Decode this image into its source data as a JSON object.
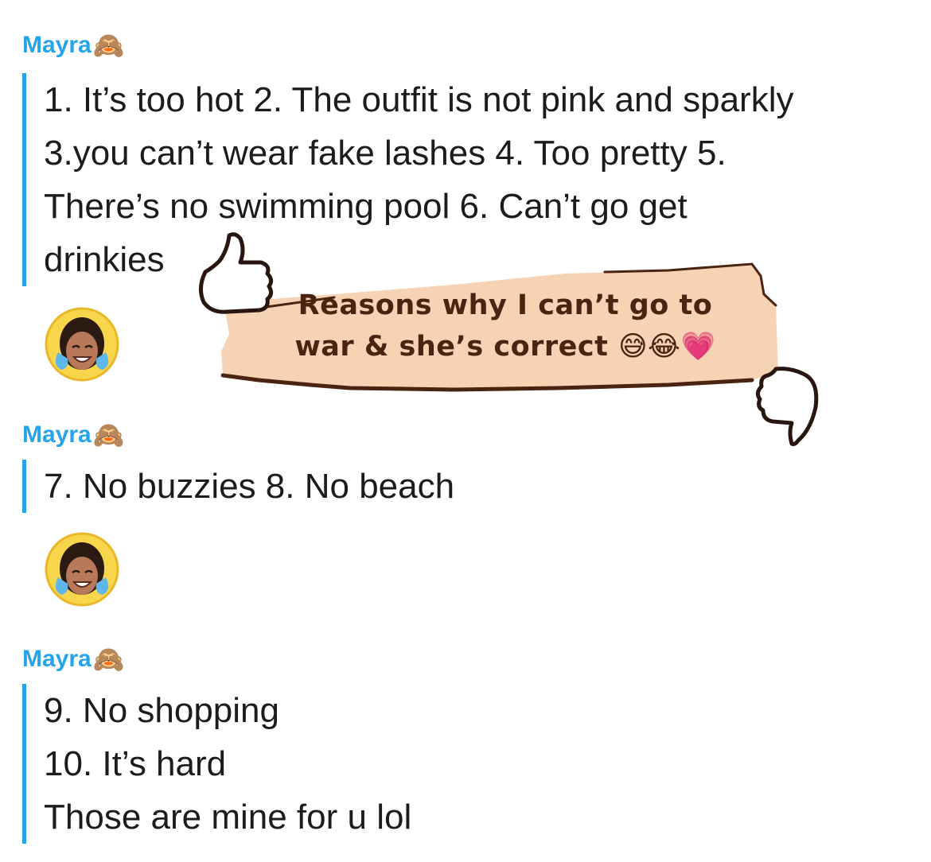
{
  "chat": {
    "sender_name": "Mayra",
    "sender_emoji": "🙈",
    "messages": [
      {
        "lines": [
          "1. It’s too hot 2. The outfit is not pink and sparkly",
          "3.you can’t wear fake lashes 4. Too pretty 5.",
          "There’s no swimming pool 6. Can’t go get",
          "drinkies"
        ]
      },
      {
        "lines": [
          "7. No buzzies 8. No beach"
        ]
      },
      {
        "lines": [
          "9. No shopping",
          "10. It’s hard",
          "Those are mine for u lol"
        ]
      }
    ],
    "reactions": [
      "bitmoji-crying-laughing",
      "bitmoji-crying-laughing"
    ]
  },
  "sticker": {
    "line1": "Reasons why I can’t go to",
    "line2": "war & she’s correct 😅😂💗"
  },
  "colors": {
    "accent": "#26a4eb",
    "text": "#1c1c1c",
    "paper": "#f6d3b4",
    "ink": "#4a2411"
  }
}
